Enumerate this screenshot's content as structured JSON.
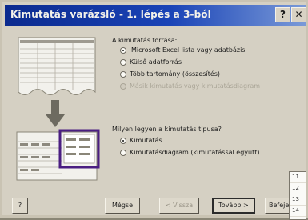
{
  "window": {
    "title": "Kimutatás varázsló - 1. lépés a 3-ból",
    "help_glyph": "?",
    "close_glyph": "✕",
    "icons": [
      "help-icon",
      "close-icon"
    ]
  },
  "source_group": {
    "label": "A kimutatás forrása:",
    "options": [
      {
        "label": "Microsoft Excel lista vagy adatbázis",
        "selected": true,
        "enabled": true
      },
      {
        "label": "Külső adatforrás",
        "selected": false,
        "enabled": true
      },
      {
        "label": "Több tartomány (összesítés)",
        "selected": false,
        "enabled": true
      },
      {
        "label": "Másik kimutatás vagy kimutatásdiagram",
        "selected": false,
        "enabled": false
      }
    ]
  },
  "type_group": {
    "label": "Milyen legyen a kimutatás típusa?",
    "options": [
      {
        "label": "Kimutatás",
        "selected": true,
        "enabled": true
      },
      {
        "label": "Kimutatásdiagram (kimutatással együtt)",
        "selected": false,
        "enabled": true
      }
    ]
  },
  "buttons": {
    "help": "?",
    "cancel": "Mégse",
    "back": "< Vissza",
    "next": "Tovább >",
    "finish": "Befejezés"
  },
  "dropdown": {
    "items": [
      "11",
      "12",
      "13",
      "14"
    ]
  },
  "colors": {
    "title_start": "#0b2a8e",
    "title_end": "#7a9ad8",
    "highlight_frame": "#4a1e82",
    "arrow": "#6d6a60"
  }
}
